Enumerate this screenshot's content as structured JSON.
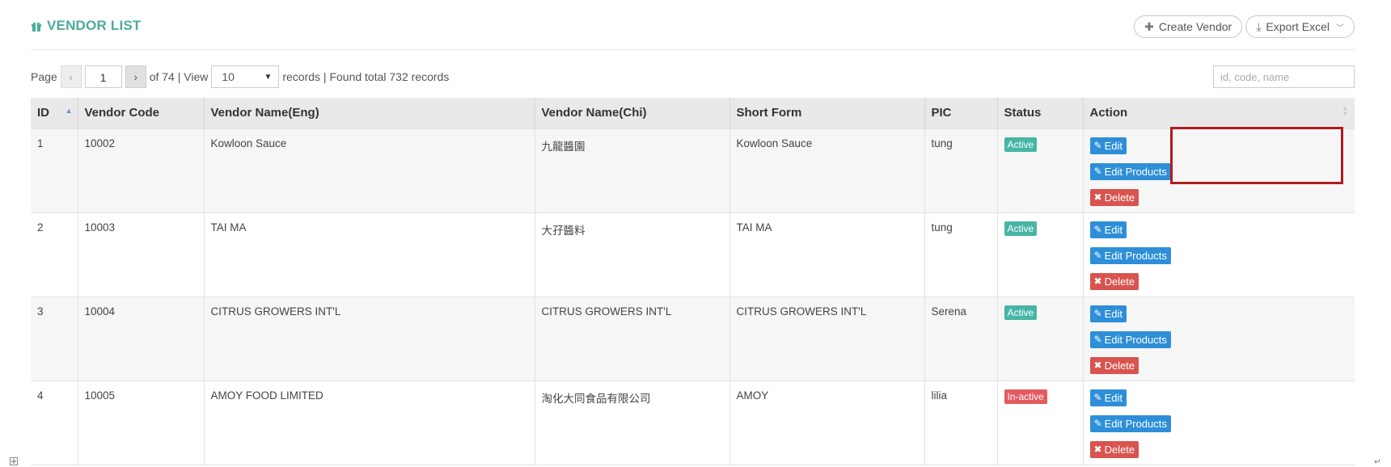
{
  "header": {
    "title": "VENDOR LIST",
    "create_label": "Create Vendor",
    "export_label": "Export Excel"
  },
  "pager": {
    "page_label": "Page",
    "prev_icon": "chevron-left",
    "next_icon": "chevron-right",
    "current_page": "1",
    "of_text": "of 74 | View",
    "page_size": "10",
    "records_text": "records | Found total 732 records",
    "search_placeholder": "id, code, name"
  },
  "table": {
    "columns": [
      "ID",
      "Vendor Code",
      "Vendor Name(Eng)",
      "Vendor Name(Chi)",
      "Short Form",
      "PIC",
      "Status",
      "Action"
    ],
    "rows": [
      {
        "id": "1",
        "code": "10002",
        "name_eng": "Kowloon Sauce",
        "name_chi": "九龍醬園",
        "short": "Kowloon Sauce",
        "pic": "tung",
        "status": "Active"
      },
      {
        "id": "2",
        "code": "10003",
        "name_eng": "TAI MA",
        "name_chi": "大孖醬料",
        "short": "TAI MA",
        "pic": "tung",
        "status": "Active"
      },
      {
        "id": "3",
        "code": "10004",
        "name_eng": "CITRUS GROWERS INT'L",
        "name_chi": "CITRUS GROWERS INT'L",
        "short": "CITRUS GROWERS INT'L",
        "pic": "Serena",
        "status": "Active"
      },
      {
        "id": "4",
        "code": "10005",
        "name_eng": "AMOY FOOD LIMITED",
        "name_chi": "淘化大同食品有限公司",
        "short": "AMOY",
        "pic": "lilia",
        "status": "In-active"
      }
    ],
    "actions": {
      "edit": "Edit",
      "edit_products": "Edit Products",
      "delete": "Delete"
    }
  },
  "colors": {
    "title": "#4aab9c",
    "active": "#47b5a5",
    "inactive": "#e35b60",
    "edit_button": "#2e8fd8",
    "delete_button": "#d9534f",
    "highlight_box": "#b01c1c"
  }
}
